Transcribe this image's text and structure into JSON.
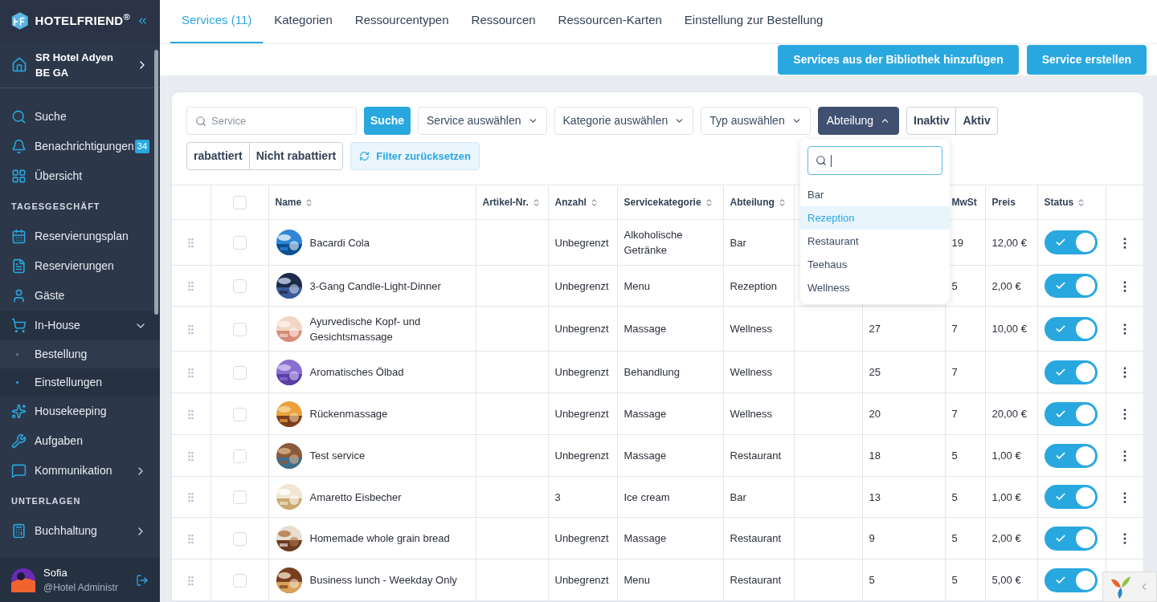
{
  "sidebar": {
    "brand": "HOTELFRIEND$^{®}$",
    "hotel": "SR Hotel Adyen BE GA",
    "items": [
      {
        "kind": "item",
        "label": "Suche"
      },
      {
        "kind": "item",
        "label": "Benachrichtigungen",
        "badge": "34"
      },
      {
        "kind": "item",
        "label": "Übersicht"
      },
      {
        "kind": "section",
        "label": "TAGESGESCHÄFT"
      },
      {
        "kind": "item",
        "label": "Reservierungsplan"
      },
      {
        "kind": "item",
        "label": "Reservierungen"
      },
      {
        "kind": "item",
        "label": "Gäste"
      },
      {
        "kind": "item",
        "label": "In-House",
        "expanded": true,
        "children": [
          {
            "label": "Bestellung",
            "selected": false
          },
          {
            "label": "Einstellungen",
            "selected": true
          }
        ]
      },
      {
        "kind": "item",
        "label": "Housekeeping"
      },
      {
        "kind": "item",
        "label": "Aufgaben"
      },
      {
        "kind": "item",
        "label": "Kommunikation",
        "expanded": false
      },
      {
        "kind": "section",
        "label": "UNTERLAGEN"
      },
      {
        "kind": "item",
        "label": "Buchhaltung",
        "expanded": false
      }
    ],
    "user": {
      "name": "Sofia",
      "role": "@Hotel Administr"
    }
  },
  "tabs": [
    {
      "label": "Services (11)",
      "selected": true
    },
    {
      "label": "Kategorien",
      "selected": false
    },
    {
      "label": "Ressourcentypen",
      "selected": false
    },
    {
      "label": "Ressourcen",
      "selected": false
    },
    {
      "label": "Ressourcen-Karten",
      "selected": false
    },
    {
      "label": "Einstellung zur Bestellung",
      "selected": false
    }
  ],
  "actions": [
    "Services aus der Bibliothek hinzufügen",
    "Service erstellen"
  ],
  "filters": {
    "search": {
      "placeholder": "Service"
    },
    "search_button": "Suche",
    "dropdowns": [
      {
        "label": "Service auswählen",
        "open": false
      },
      {
        "label": "Kategorie auswählen",
        "open": false
      },
      {
        "label": "Typ auswählen",
        "open": false
      },
      {
        "label": "Abteilung",
        "open": true
      }
    ],
    "status_toggle": [
      "Inaktiv",
      "Aktiv"
    ],
    "discount_toggle": [
      "rabattiert",
      "Nicht rabattiert"
    ],
    "reset": "Filter zurücksetzen"
  },
  "department_menu": {
    "options": [
      {
        "label": "Bar",
        "selected": false
      },
      {
        "label": "Rezeption",
        "selected": true
      },
      {
        "label": "Restaurant",
        "selected": false
      },
      {
        "label": "Teehaus",
        "selected": false
      },
      {
        "label": "Wellness",
        "selected": false
      }
    ]
  },
  "table": {
    "select_all_checked": false,
    "columns": [
      {
        "label": "Name",
        "sortable": true
      },
      {
        "label": "Artikel-Nr.",
        "sortable": true
      },
      {
        "label": "Anzahl",
        "sortable": true
      },
      {
        "label": "Servicekategorie",
        "sortable": true
      },
      {
        "label": "Abteilung",
        "sortable": true
      },
      {
        "label": "MwSt",
        "sortable": false
      },
      {
        "label": "Preis",
        "sortable": false
      },
      {
        "label": "Status",
        "sortable": true
      }
    ],
    "rows": [
      {
        "name": "Bacardi Cola",
        "anzahl": "Unbegrenzt",
        "kategorie": "Alkoholische Getränke",
        "abteilung": "Bar",
        "mwst": "19",
        "preis": "12,00 €",
        "status_on": true,
        "checked": false
      },
      {
        "name": "3-Gang Candle-Light-Dinner",
        "anzahl": "Unbegrenzt",
        "kategorie": "Menu",
        "abteilung": "Rezeption",
        "mwst": "5",
        "preis": "2,00 €",
        "status_on": true,
        "checked": false
      },
      {
        "name": "Ayurvedische Kopf- und Gesichtsmassage",
        "anzahl": "Unbegrenzt",
        "kategorie": "Massage",
        "abteilung": "Wellness",
        "column_8": "27",
        "mwst": "7",
        "preis": "10,00 €",
        "status_on": true,
        "checked": false
      },
      {
        "name": "Aromatisches Ölbad",
        "anzahl": "Unbegrenzt",
        "kategorie": "Behandlung",
        "abteilung": "Wellness",
        "column_8": "25",
        "mwst": "7",
        "status_on": true,
        "checked": false
      },
      {
        "name": "Rückenmassage",
        "anzahl": "Unbegrenzt",
        "kategorie": "Massage",
        "abteilung": "Wellness",
        "column_8": "20",
        "mwst": "7",
        "preis": "20,00 €",
        "status_on": true,
        "checked": false
      },
      {
        "name": "Test service",
        "anzahl": "Unbegrenzt",
        "kategorie": "Massage",
        "abteilung": "Restaurant",
        "column_8": "18",
        "mwst": "5",
        "preis": "1,00 €",
        "status_on": true,
        "checked": false
      },
      {
        "name": "Amaretto Eisbecher",
        "anzahl": "3",
        "kategorie": "Ice cream",
        "abteilung": "Bar",
        "column_8": "13",
        "mwst": "5",
        "preis": "1,00 €",
        "status_on": true,
        "checked": false
      },
      {
        "name": "Homemade whole grain bread",
        "anzahl": "Unbegrenzt",
        "kategorie": "Massage",
        "abteilung": "Restaurant",
        "column_8": "9",
        "mwst": "5",
        "preis": "2,00 €",
        "status_on": true,
        "checked": false
      },
      {
        "name": "Business lunch - Weekday Only",
        "anzahl": "Unbegrenzt",
        "kategorie": "Menu",
        "abteilung": "Restaurant",
        "column_8": "5",
        "mwst": "5",
        "preis": "5,00 €",
        "status_on": true,
        "checked": false
      }
    ]
  }
}
